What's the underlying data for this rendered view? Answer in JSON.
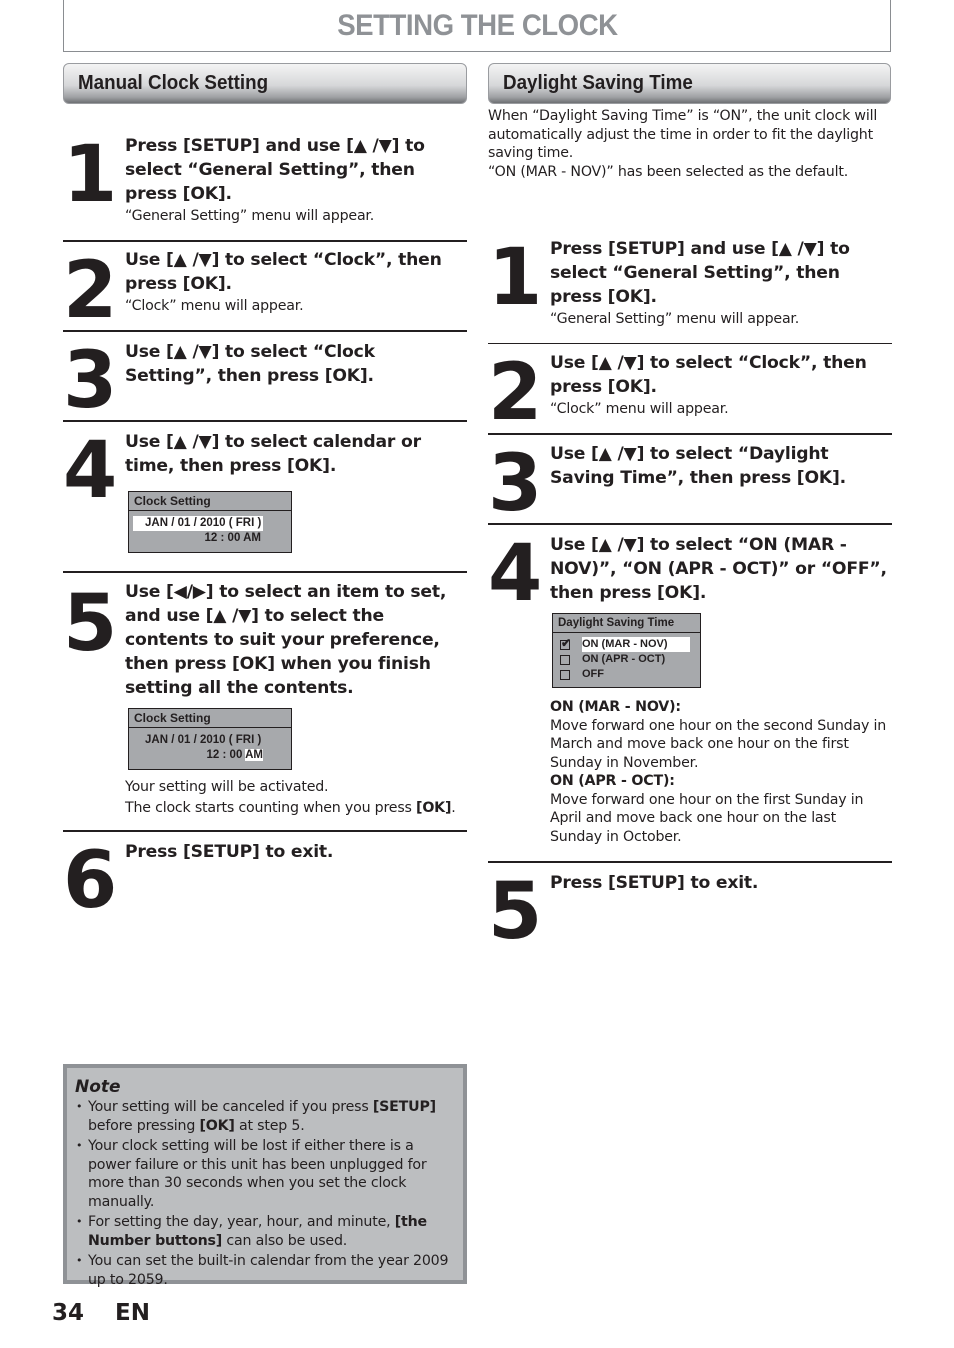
{
  "page": {
    "title": "SETTING THE CLOCK",
    "page_number": "34",
    "language": "EN"
  },
  "manual": {
    "header": "Manual Clock Setting",
    "steps": [
      {
        "num": "1",
        "title": "Press [SETUP] and use [▲ /▼] to select “General Setting”, then press [OK].",
        "desc": "“General Setting” menu will appear."
      },
      {
        "num": "2",
        "title": "Use [▲ /▼] to select “Clock”, then press [OK].",
        "desc": "“Clock” menu will appear."
      },
      {
        "num": "3",
        "title": "Use [▲ /▼] to select “Clock Setting”, then press [OK].",
        "desc": ""
      },
      {
        "num": "4",
        "title": "Use [▲ /▼] to select calendar or time, then press [OK].",
        "desc": ""
      },
      {
        "num": "5",
        "title": "Use [◀/▶] to select an item to set, and use [▲ /▼] to select the contents to suit your preference, then press [OK] when you finish setting all the contents.",
        "desc1": "Your setting will be activated.",
        "desc2_pre": "The clock starts counting when you press ",
        "desc2_bold": "[OK]",
        "desc2_post": "."
      },
      {
        "num": "6",
        "title": "Press [SETUP] to exit.",
        "desc": ""
      }
    ],
    "osd1": {
      "title": "Clock Setting",
      "date": "JAN / 01 / 2010 ( FRI )",
      "time": "12 : 00 AM"
    },
    "osd2": {
      "title": "Clock Setting",
      "date": "JAN / 01 / 2010 ( FRI )",
      "time_pre": "12 : 00 ",
      "time_hl": "AM"
    }
  },
  "dst": {
    "header": "Daylight Saving Time",
    "intro1": "When “Daylight Saving Time” is “ON”, the unit clock will automatically adjust the time in order to fit the daylight saving time.",
    "intro2": "“ON (MAR - NOV)” has been selected as the default.",
    "steps": [
      {
        "num": "1",
        "title": "Press [SETUP] and use [▲ /▼] to select “General Setting”, then press [OK].",
        "desc": "“General Setting” menu will appear."
      },
      {
        "num": "2",
        "title": "Use [▲ /▼] to select “Clock”, then press [OK].",
        "desc": "“Clock” menu will appear."
      },
      {
        "num": "3",
        "title": "Use [▲ /▼] to select “Daylight Saving Time”, then press [OK].",
        "desc": ""
      },
      {
        "num": "4",
        "title": "Use [▲ /▼] to select “ON (MAR - NOV)”, “ON (APR - OCT)” or “OFF”, then press [OK].",
        "desc": ""
      },
      {
        "num": "5",
        "title": "Press [SETUP] to exit.",
        "desc": ""
      }
    ],
    "osd": {
      "title": "Daylight Saving Time",
      "options": [
        {
          "label": "ON (MAR - NOV)",
          "checked": true
        },
        {
          "label": "ON (APR - OCT)",
          "checked": false
        },
        {
          "label": "OFF",
          "checked": false
        }
      ]
    },
    "explain": [
      {
        "term": "ON (MAR - NOV):",
        "text": "Move forward one hour on the second Sunday in March and move back one hour on the first Sunday in November."
      },
      {
        "term": "ON (APR - OCT):",
        "text": "Move forward one hour on the first Sunday in April and move back one hour on the last Sunday in October."
      }
    ]
  },
  "note": {
    "title": "Note",
    "items": [
      {
        "pre": "Your setting will be canceled if you press ",
        "b1": "[SETUP]",
        "mid": " before pressing ",
        "b2": "[OK]",
        "post": " at step 5."
      },
      {
        "text": "Your clock setting will be lost if either there is a power failure or this unit has been unplugged for more than 30 seconds when you set the clock manually."
      },
      {
        "pre": "For setting the day, year, hour, and minute, ",
        "b1": "[the Number buttons]",
        "post": " can also be used."
      },
      {
        "text": "You can set the built-in calendar from the year 2009 up to 2059."
      }
    ]
  }
}
